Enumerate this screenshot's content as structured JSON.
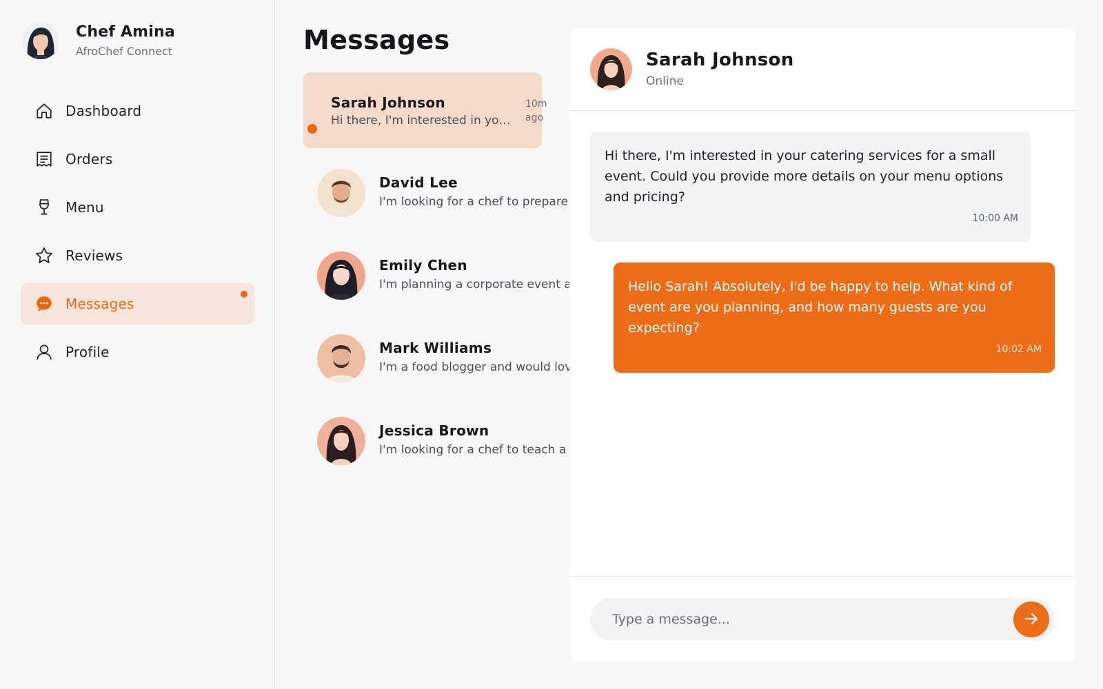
{
  "colors": {
    "accent": "#e8681a",
    "accent_bubble": "#ec6c18",
    "selected_bg": "#f6dac9",
    "active_nav_bg": "#f5e5da"
  },
  "profile": {
    "name": "Chef Amina",
    "subtitle": "AfroChef Connect",
    "avatar": "woman-avatar"
  },
  "nav": [
    {
      "label": "Dashboard",
      "icon": "home-icon",
      "active": false
    },
    {
      "label": "Orders",
      "icon": "receipt-icon",
      "active": false
    },
    {
      "label": "Menu",
      "icon": "wine-glass-icon",
      "active": false
    },
    {
      "label": "Reviews",
      "icon": "star-icon",
      "active": false
    },
    {
      "label": "Messages",
      "icon": "chat-bubble-icon",
      "active": true,
      "has_notification": true
    },
    {
      "label": "Profile",
      "icon": "user-icon",
      "active": false
    }
  ],
  "messages_list": {
    "title": "Messages",
    "threads": [
      {
        "name": "Sarah Johnson",
        "preview": "Hi there, I'm interested in your catering services for a small event.",
        "time": "10m ago",
        "selected": true,
        "unread": true
      },
      {
        "name": "David Lee",
        "preview": "I'm looking for a chef to prepare a",
        "selected": false
      },
      {
        "name": "Emily Chen",
        "preview": "I'm planning a corporate event ar",
        "selected": false
      },
      {
        "name": "Mark Williams",
        "preview": "I'm a food blogger and would lov",
        "selected": false
      },
      {
        "name": "Jessica Brown",
        "preview": "I'm looking for a chef to teach a c",
        "selected": false
      }
    ]
  },
  "chat": {
    "contact_name": "Sarah Johnson",
    "contact_status": "Online",
    "messages": [
      {
        "direction": "incoming",
        "text": "Hi there, I'm interested in your catering services for a small event. Could you provide more details on your menu options and pricing?",
        "time": "10:00 AM"
      },
      {
        "direction": "outgoing",
        "text": "Hello Sarah! Absolutely, I'd be happy to help. What kind of event are you planning, and how many guests are you expecting?",
        "time": "10:02 AM"
      }
    ],
    "composer": {
      "placeholder": "Type a message...",
      "value": "",
      "send_icon": "arrow-right-icon"
    }
  }
}
